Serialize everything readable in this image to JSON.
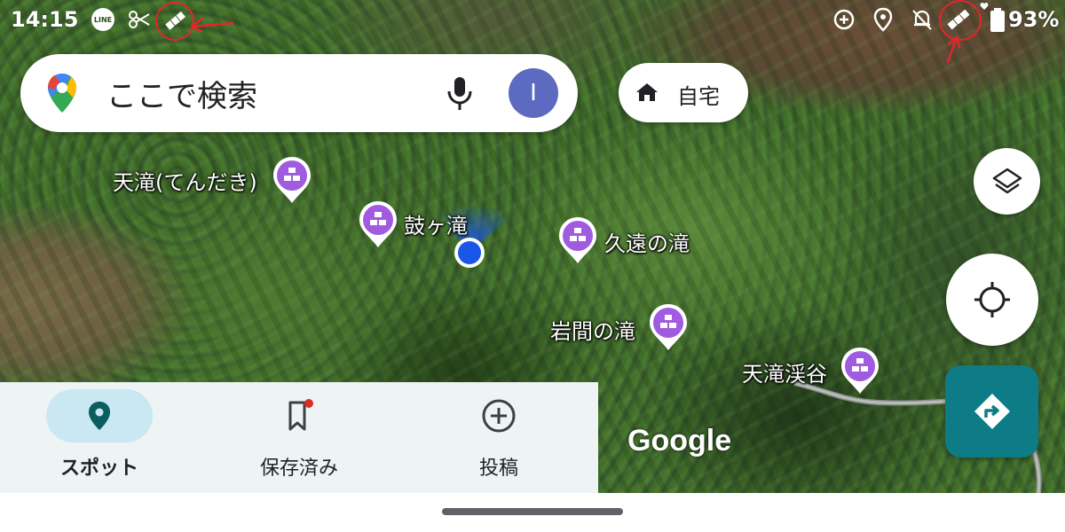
{
  "status_bar": {
    "time": "14:15",
    "battery": "93%",
    "left_icons": [
      "line-icon",
      "scissors-icon",
      "satellite-icon"
    ],
    "right_icons": [
      "data-saver-icon",
      "location-icon",
      "mute-bell-icon",
      "satellite-icon",
      "battery-icon"
    ]
  },
  "search": {
    "placeholder": "ここで検索",
    "avatar_letter": "I"
  },
  "home_chip": {
    "label": "自宅"
  },
  "map_pois": [
    {
      "name": "天滝(てんだき)"
    },
    {
      "name": "鼓ヶ滝"
    },
    {
      "name": "久遠の滝"
    },
    {
      "name": "岩間の滝"
    },
    {
      "name": "天滝渓谷"
    }
  ],
  "map_attribution": "Google",
  "bottom_nav": {
    "items": [
      {
        "label": "スポット",
        "icon": "explore-pin-icon",
        "active": true
      },
      {
        "label": "保存済み",
        "icon": "bookmark-icon",
        "active": false
      },
      {
        "label": "投稿",
        "icon": "add-circle-icon",
        "active": false
      }
    ]
  },
  "colors": {
    "accent": "#0e7c86",
    "poi_pin": "#a05be0",
    "location_dot": "#1a57e8",
    "nav_active_bg": "#c9e8f3",
    "annotation_red": "#e3262b"
  }
}
